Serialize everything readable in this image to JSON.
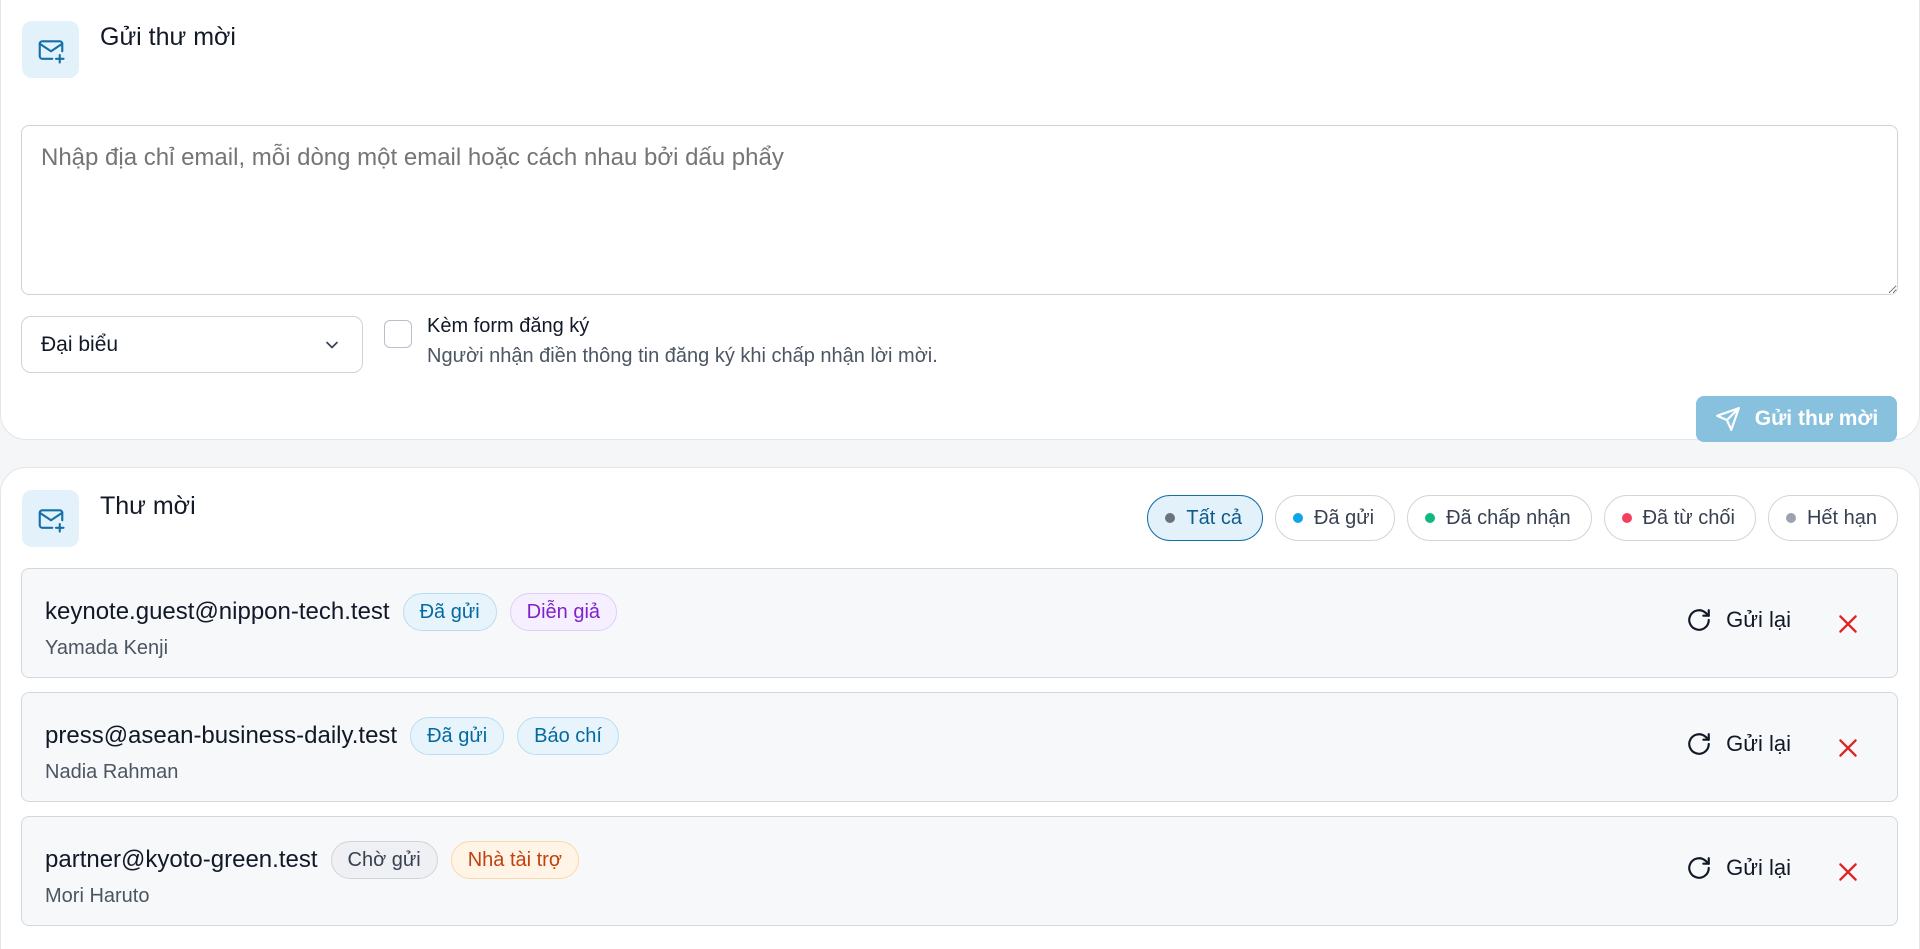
{
  "send_section": {
    "icon": "mail-plus-icon",
    "title": "Gửi thư mời",
    "emails_placeholder": "Nhập địa chỉ email, mỗi dòng một email hoặc cách nhau bởi dấu phẩy",
    "emails_value": "",
    "role_select": {
      "value": "Đại biểu"
    },
    "registration_checkbox": {
      "checked": false,
      "label": "Kèm form đăng ký",
      "help": "Người nhận điền thông tin đăng ký khi chấp nhận lời mời."
    },
    "send_button": {
      "label": "Gửi thư mời",
      "icon": "send-icon",
      "disabled": true
    }
  },
  "list_section": {
    "icon": "mail-plus-icon",
    "title": "Thư mời",
    "filters": [
      {
        "label": "Tất cả",
        "dot_color": "#6b7280",
        "active": true
      },
      {
        "label": "Đã gửi",
        "dot_color": "#0ea5e9",
        "active": false
      },
      {
        "label": "Đã chấp nhận",
        "dot_color": "#10b981",
        "active": false
      },
      {
        "label": "Đã từ chối",
        "dot_color": "#f43f5e",
        "active": false
      },
      {
        "label": "Hết hạn",
        "dot_color": "#9ca3af",
        "active": false
      }
    ],
    "invitations": [
      {
        "email": "keynote.guest@nippon-tech.test",
        "name": "Yamada Kenji",
        "status": {
          "label": "Đã gửi",
          "color": "#0369a1",
          "bg": "#e8f4fc",
          "border": "#b9def3"
        },
        "role": {
          "label": "Diễn giả",
          "color": "#7e22ce",
          "bg": "#f6efff",
          "border": "#e1cdfb"
        },
        "resend_label": "Gửi lại"
      },
      {
        "email": "press@asean-business-daily.test",
        "name": "Nadia Rahman",
        "status": {
          "label": "Đã gửi",
          "color": "#0369a1",
          "bg": "#e8f4fc",
          "border": "#b9def3"
        },
        "role": {
          "label": "Báo chí",
          "color": "#0369a1",
          "bg": "#e8f4fc",
          "border": "#b9def3"
        },
        "resend_label": "Gửi lại"
      },
      {
        "email": "partner@kyoto-green.test",
        "name": "Mori Haruto",
        "status": {
          "label": "Chờ gửi",
          "color": "#374151",
          "bg": "#eef0f3",
          "border": "#d1d5db"
        },
        "role": {
          "label": "Nhà tài trợ",
          "color": "#c2410c",
          "bg": "#fff4e6",
          "border": "#fcd8a8"
        },
        "resend_label": "Gửi lại"
      }
    ]
  },
  "colors": {
    "accent": "#1470a8",
    "danger": "#dc2626"
  }
}
